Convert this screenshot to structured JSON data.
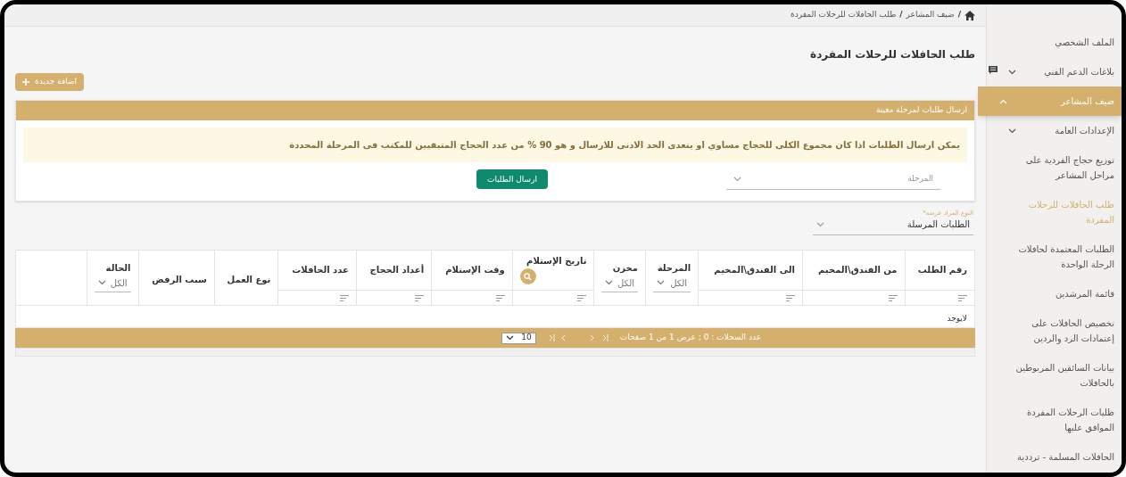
{
  "breadcrumb": [
    "ضيف المشاعر",
    "طلب الحافلات للرحلات المفردة"
  ],
  "breadcrumb_separator": "/",
  "page_title": "طلب الحافلات للرحلات المفردة",
  "add_button": "اضافة جديدة",
  "send_panel": {
    "title": "ارسال طلبات لمرحلة معينة",
    "notice": "يمكن ارسال الطلبات اذا كان مجموع الكلى للحجاج مساوي او يتعدى الحد الادنى للارسال و هو 90 % من عدد الحجاج المتبقيين للمكتب فى المرحلة المحددة",
    "stage_placeholder": "المرحلة",
    "send_button": "ارسال الطلبات"
  },
  "type_select": {
    "label": "النوع المراد عرضه*",
    "value": "الطلبات المرسلة"
  },
  "table": {
    "columns": [
      {
        "kind": "filter",
        "label": "رقم الطلب"
      },
      {
        "kind": "filter",
        "label": "من الفندق\\المخيم"
      },
      {
        "kind": "filter",
        "label": "الى الفندق\\المخيم"
      },
      {
        "kind": "select",
        "label": "المرحلة",
        "value": "الكل"
      },
      {
        "kind": "select",
        "label": "مخزن",
        "value": "الكل"
      },
      {
        "kind": "date",
        "label": "تاريخ الإستلام"
      },
      {
        "kind": "filter",
        "label": "وقت الإستلام"
      },
      {
        "kind": "filter",
        "label": "أعداد الحجاج"
      },
      {
        "kind": "filter",
        "label": "عدد الحافلات"
      },
      {
        "kind": "plain",
        "label": "نوع العمل"
      },
      {
        "kind": "plain",
        "label": "سبب الرفض"
      },
      {
        "kind": "select",
        "label": "الحالة",
        "value": "الكل"
      },
      {
        "kind": "blank"
      }
    ],
    "empty_text": "لايوجد",
    "records_text": "عدد السجلات : 0 ; عرض 1 من 1 صفحات",
    "page_size": "10"
  },
  "sidebar": {
    "items": [
      {
        "label": "الملف الشخصي",
        "selected": false
      },
      {
        "label": "بلاغات الدعم الفني",
        "selected": false,
        "expanded": false
      },
      {
        "label": "ضيف المشاعر",
        "selected": true,
        "expanded": true,
        "children": [
          {
            "label": "الإعدادات العامة",
            "selected": false,
            "expanded": false
          },
          {
            "label": "توزيع حجاج الفردية على مراحل المشاعر",
            "selected": false
          },
          {
            "label": "طلب الحافلات للرحلات المفردة",
            "selected": true
          },
          {
            "label": "الطلبات المعتمدة لحافلات الرحلة الواحدة",
            "selected": false
          },
          {
            "label": "قائمة المرشدين",
            "selected": false
          },
          {
            "label": "تخصيص الحافلات على إعتمادات الرد والردين",
            "selected": false
          },
          {
            "label": "بيانات السائقين المربوطين بالحافلات",
            "selected": false
          },
          {
            "label": "طلبات الرحلات المفردة الموافق عليها",
            "selected": false
          },
          {
            "label": "الحافلات المسلمة - ترددية",
            "selected": false
          }
        ]
      }
    ]
  }
}
